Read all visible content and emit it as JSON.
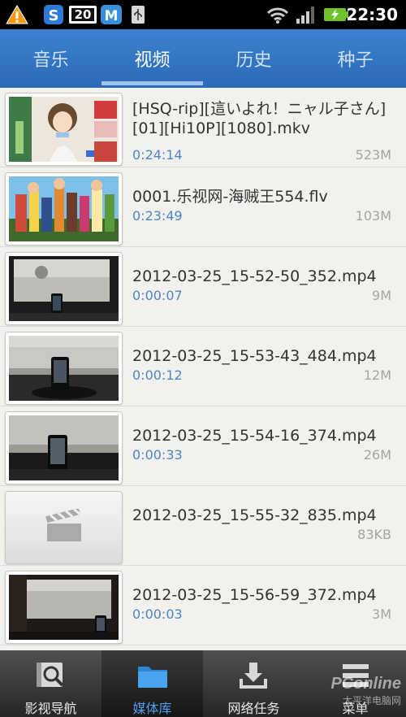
{
  "status_bar": {
    "time": "22:30",
    "icons": [
      "warning-icon",
      "sogou-s-icon",
      "badge-20-icon",
      "maxthon-m-icon",
      "usb-icon",
      "wifi-icon",
      "signal-icon",
      "battery-charging-icon"
    ],
    "badge_text": "20"
  },
  "tabs": [
    {
      "label": "音乐",
      "active": false
    },
    {
      "label": "视频",
      "active": true
    },
    {
      "label": "历史",
      "active": false
    },
    {
      "label": "种子",
      "active": false
    }
  ],
  "videos": [
    {
      "title": "[HSQ-rip][這いよれ！ニャル子さん][01][Hi10P][1080].mkv",
      "duration": "0:24:14",
      "size": "523M",
      "thumb": "anime-girl"
    },
    {
      "title": "0001.乐视网-海贼王554.flv",
      "duration": "0:23:49",
      "size": "103M",
      "thumb": "one-piece"
    },
    {
      "title": "2012-03-25_15-52-50_352.mp4",
      "duration": "0:00:07",
      "size": "9M",
      "thumb": "desk-phone-1"
    },
    {
      "title": "2012-03-25_15-53-43_484.mp4",
      "duration": "0:00:12",
      "size": "12M",
      "thumb": "desk-phone-2"
    },
    {
      "title": "2012-03-25_15-54-16_374.mp4",
      "duration": "0:00:33",
      "size": "26M",
      "thumb": "desk-phone-3"
    },
    {
      "title": "2012-03-25_15-55-32_835.mp4",
      "duration": "",
      "size": "83KB",
      "thumb": "placeholder"
    },
    {
      "title": "2012-03-25_15-56-59_372.mp4",
      "duration": "0:00:03",
      "size": "3M",
      "thumb": "dark-room"
    }
  ],
  "bottom_nav": [
    {
      "label": "影视导航",
      "icon": "film-search-icon",
      "active": false
    },
    {
      "label": "媒体库",
      "icon": "folder-icon",
      "active": true
    },
    {
      "label": "网络任务",
      "icon": "download-icon",
      "active": false
    },
    {
      "label": "菜单",
      "icon": "menu-icon",
      "active": false
    }
  ],
  "watermark": {
    "brand": "PConline",
    "sub": "太平洋电脑网"
  },
  "colors": {
    "tab_bg": "#2f72c0",
    "duration": "#4c86c6",
    "size": "#a4a4a4",
    "active_nav": "#4f9ff0"
  }
}
